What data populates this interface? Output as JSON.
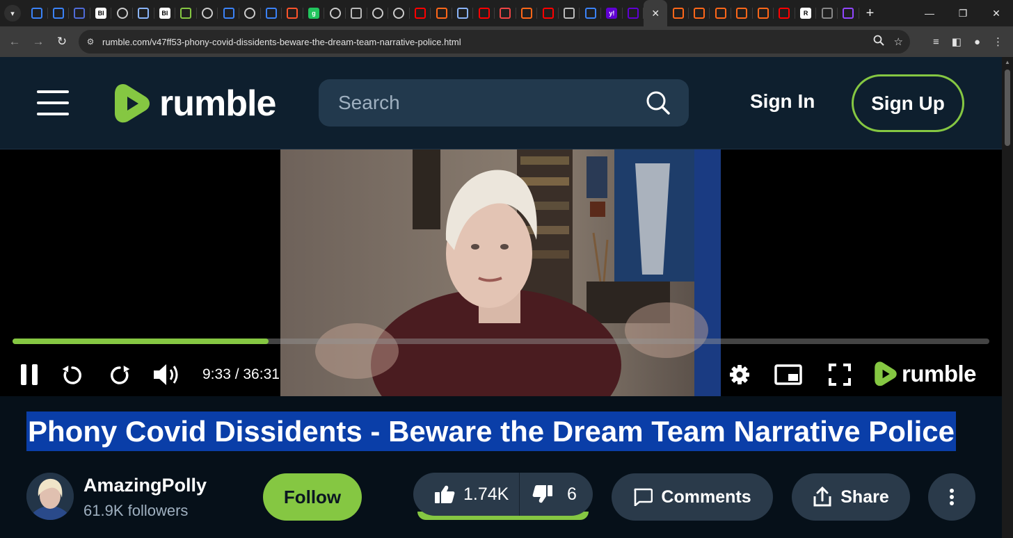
{
  "browser": {
    "tabs": [
      {
        "icon": "shield-icon",
        "color": "#3b82f6",
        "label": ""
      },
      {
        "icon": "shield-icon",
        "color": "#3b82f6",
        "label": ""
      },
      {
        "icon": "play-icon",
        "color": "#4f6bd8",
        "label": ""
      },
      {
        "icon": "bi-icon",
        "color": "#ffffff",
        "label": "BI"
      },
      {
        "icon": "globe-icon",
        "color": "#cccccc",
        "label": ""
      },
      {
        "icon": "search-icon",
        "color": "#8ab4f8",
        "label": ""
      },
      {
        "icon": "bi-icon",
        "color": "#ffffff",
        "label": "BI"
      },
      {
        "icon": "rumble-icon",
        "color": "#85c742",
        "label": ""
      },
      {
        "icon": "globe-icon",
        "color": "#cccccc",
        "label": ""
      },
      {
        "icon": "shield-icon",
        "color": "#3b82f6",
        "label": ""
      },
      {
        "icon": "globe-icon",
        "color": "#cccccc",
        "label": ""
      },
      {
        "icon": "cube-icon",
        "color": "#3b82f6",
        "label": ""
      },
      {
        "icon": "brave-icon",
        "color": "#fb542b",
        "label": ""
      },
      {
        "icon": "g-icon",
        "color": "#22c55e",
        "label": "g"
      },
      {
        "icon": "globe-icon",
        "color": "#cccccc",
        "label": ""
      },
      {
        "icon": "slash-icon",
        "color": "#bbbbbb",
        "label": ""
      },
      {
        "icon": "globe-icon",
        "color": "#cccccc",
        "label": ""
      },
      {
        "icon": "globe-icon",
        "color": "#cccccc",
        "label": ""
      },
      {
        "icon": "youtube-icon",
        "color": "#ff0000",
        "label": ""
      },
      {
        "icon": "substack-icon",
        "color": "#ff6719",
        "label": ""
      },
      {
        "icon": "search-icon",
        "color": "#8ab4f8",
        "label": ""
      },
      {
        "icon": "youtube-icon",
        "color": "#ff0000",
        "label": ""
      },
      {
        "icon": "mic-icon",
        "color": "#ef4444",
        "label": ""
      },
      {
        "icon": "substack-icon",
        "color": "#ff6719",
        "label": ""
      },
      {
        "icon": "youtube-icon",
        "color": "#ff0000",
        "label": ""
      },
      {
        "icon": "slash-icon",
        "color": "#bbbbbb",
        "label": ""
      },
      {
        "icon": "c-icon",
        "color": "#3b82f6",
        "label": ""
      },
      {
        "icon": "yahoo-icon",
        "color": "#6001d2",
        "label": "y!"
      },
      {
        "icon": "mail-icon",
        "color": "#6001d2",
        "label": ""
      },
      {
        "icon": "close-icon",
        "color": "#e8e8e8",
        "label": "",
        "active": true
      },
      {
        "icon": "substack-icon",
        "color": "#ff6719",
        "label": ""
      },
      {
        "icon": "substack-icon",
        "color": "#ff6719",
        "label": ""
      },
      {
        "icon": "substack-icon",
        "color": "#ff6719",
        "label": ""
      },
      {
        "icon": "substack-icon",
        "color": "#ff6719",
        "label": ""
      },
      {
        "icon": "substack-icon",
        "color": "#ff6719",
        "label": ""
      },
      {
        "icon": "youtube-icon",
        "color": "#ff0000",
        "label": ""
      },
      {
        "icon": "re-icon",
        "color": "#ffffff",
        "label": "R"
      },
      {
        "icon": "cult-icon",
        "color": "#888888",
        "label": ""
      },
      {
        "icon": "twitch-icon",
        "color": "#9146ff",
        "label": ""
      }
    ],
    "url": "rumble.com/v47ff53-phony-covid-dissidents-beware-the-dream-team-narrative-police.html"
  },
  "header": {
    "logo_text": "rumble",
    "search_placeholder": "Search",
    "signin_label": "Sign In",
    "signup_label": "Sign Up"
  },
  "player": {
    "time_text": "9:33 / 36:31",
    "progress_fraction": 0.2624,
    "logo_text": "rumble"
  },
  "video": {
    "title": "Phony Covid Dissidents - Beware the Dream Team Narrative Police",
    "channel_name": "AmazingPolly",
    "followers": "61.9K followers",
    "follow_label": "Follow",
    "likes": "1.74K",
    "dislikes": "6",
    "comments_label": "Comments",
    "share_label": "Share"
  },
  "colors": {
    "accent": "#85c742",
    "header_bg": "#0e1f2e",
    "title_highlight": "#0a3ea8"
  }
}
